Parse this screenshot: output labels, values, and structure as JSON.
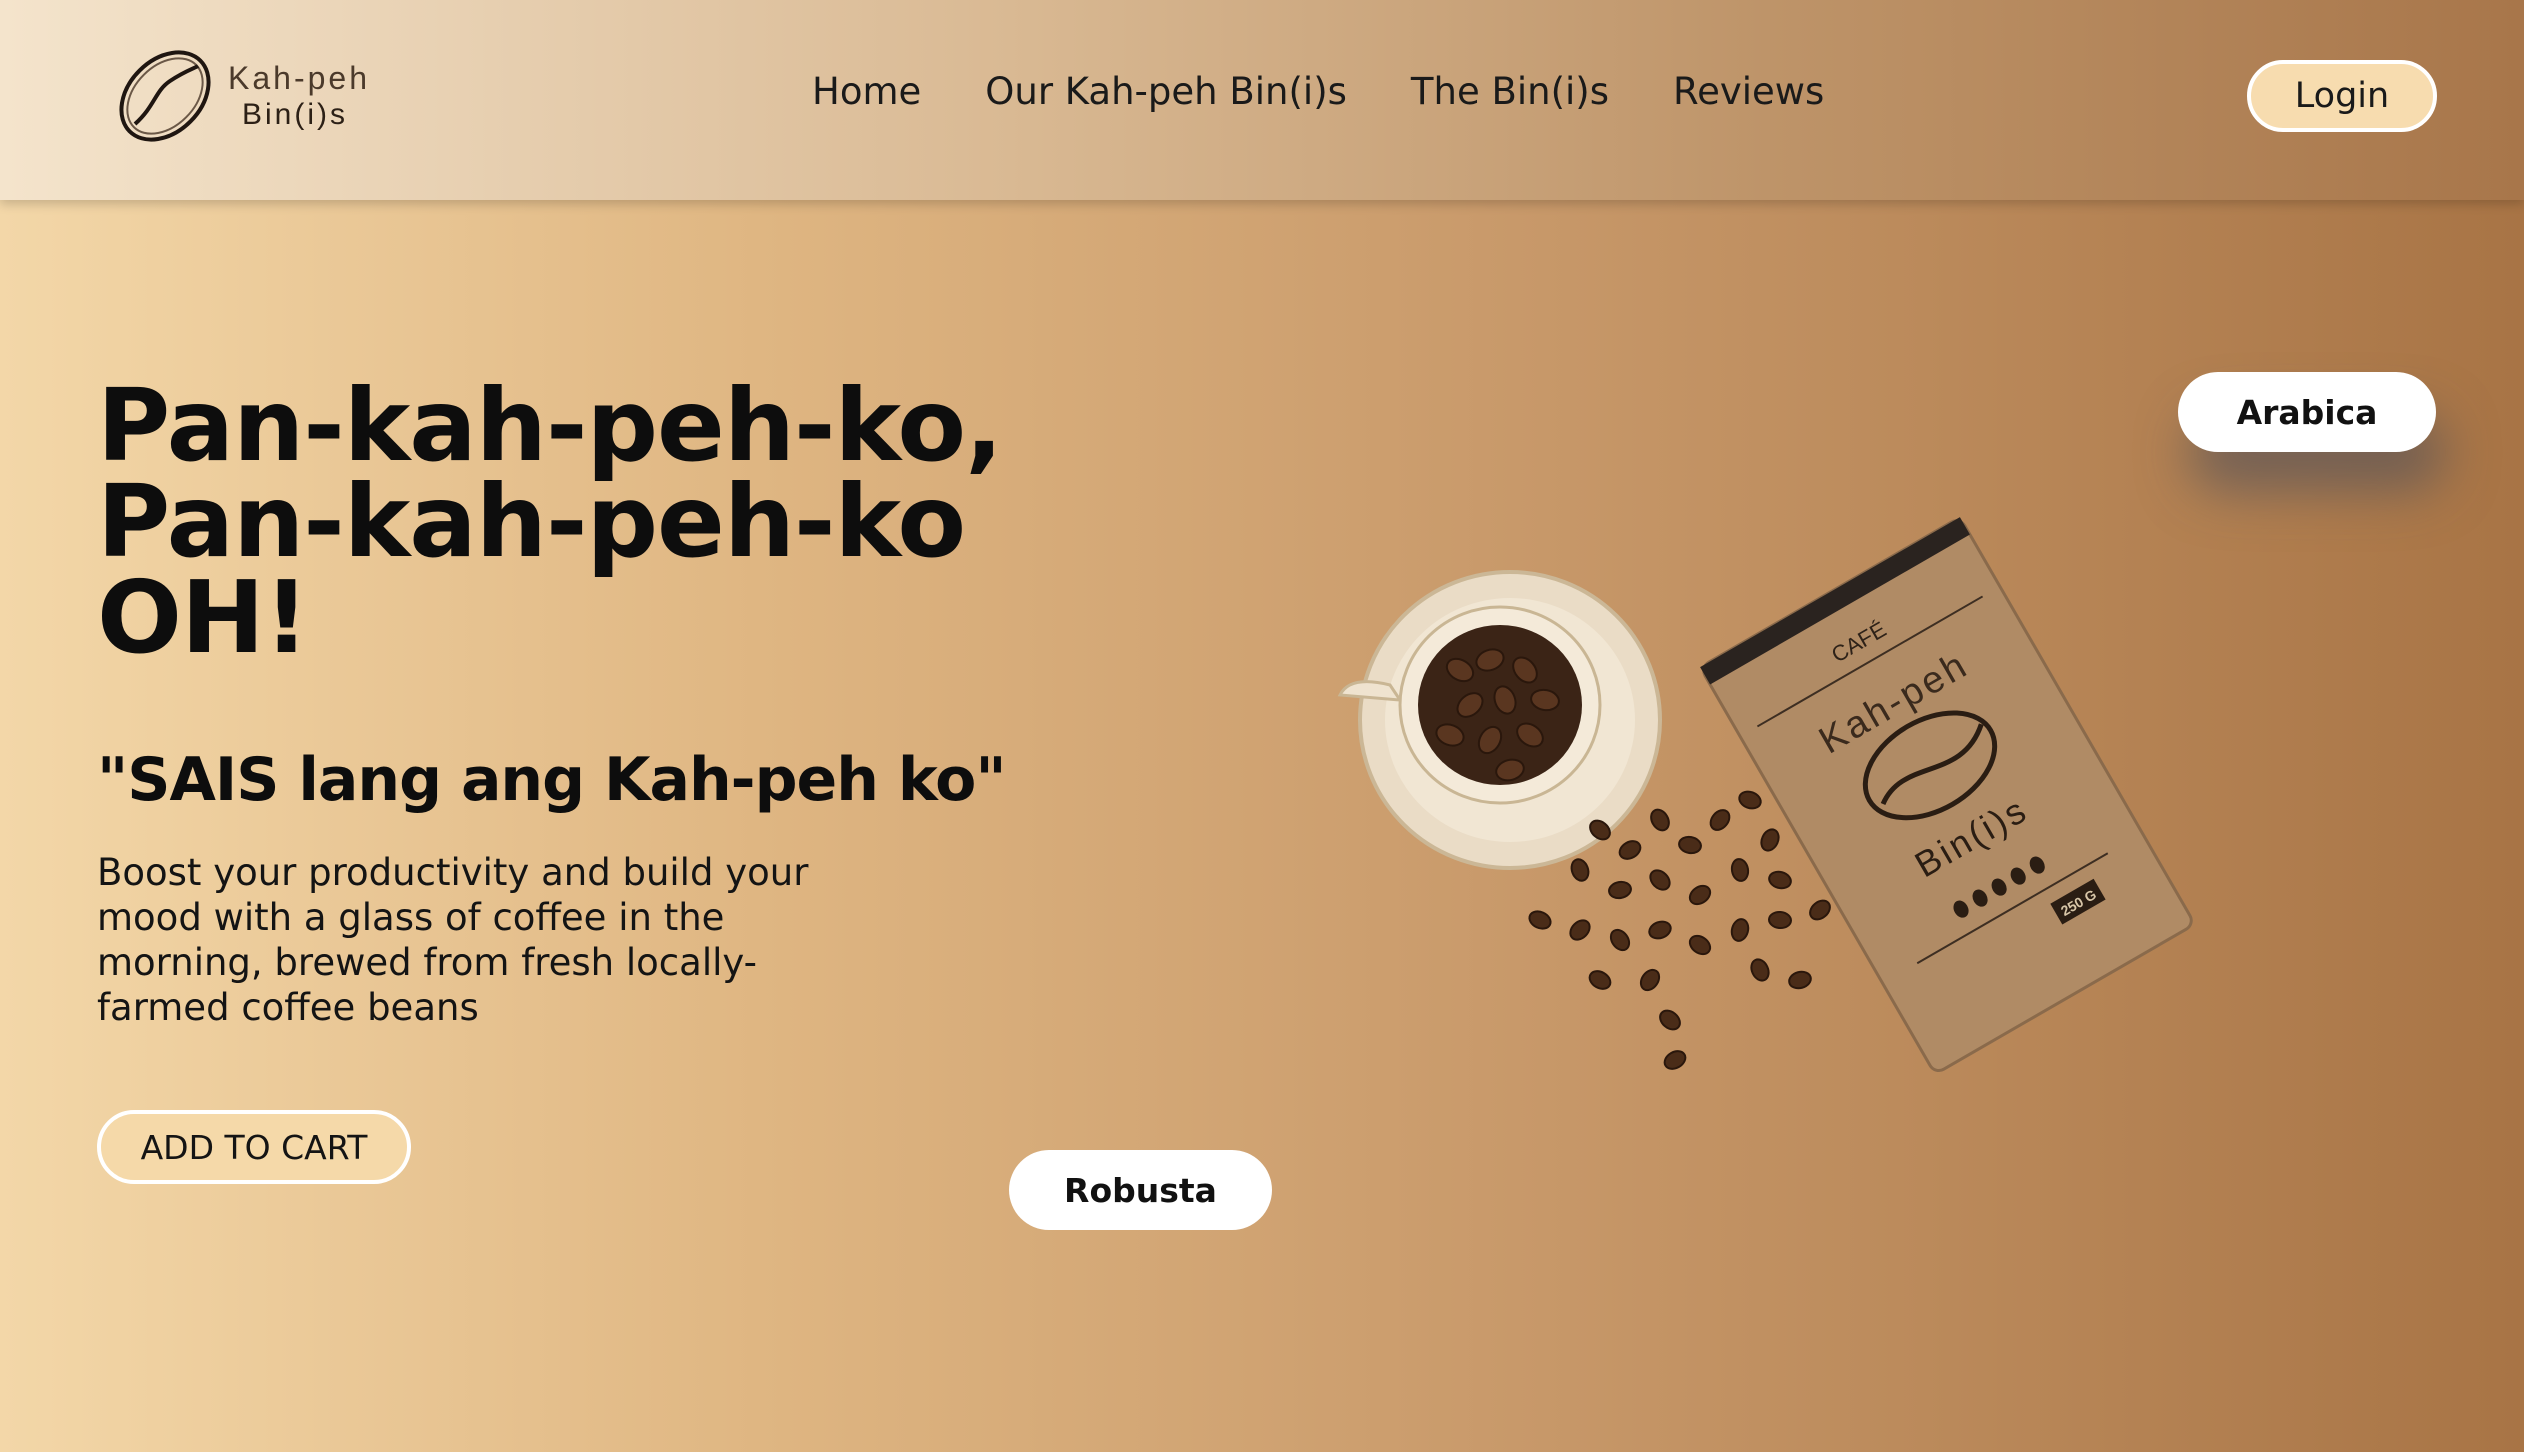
{
  "brand": {
    "line1": "Kah-peh",
    "line2": "Bin(i)s"
  },
  "nav": {
    "items": [
      {
        "label": "Home"
      },
      {
        "label": "Our Kah-peh Bin(i)s"
      },
      {
        "label": "The Bin(i)s"
      },
      {
        "label": "Reviews"
      }
    ],
    "login_label": "Login"
  },
  "hero": {
    "title_lines": [
      "Pan-kah-peh-ko,",
      "Pan-kah-peh-ko",
      "OH!"
    ],
    "tagline": "\"SAIS lang ang Kah-peh ko\"",
    "body": "Boost your productivity and build your mood with a glass of coffee in the morning, brewed from fresh locally-farmed coffee beans",
    "cta_label": "ADD TO CART"
  },
  "variants": {
    "arabica": "Arabica",
    "robusta": "Robusta"
  },
  "product_image": {
    "bag_label_top": "CAFÉ",
    "bag_brand_line1": "Kah-peh",
    "bag_brand_line2": "Bin(i)s",
    "bag_weight": "250 G",
    "icons": [
      "coffee-cup-icon",
      "coffee-bag-icon",
      "coffee-bean-icon"
    ]
  },
  "colors": {
    "cta_fill": "#f5d9a9",
    "login_fill": "#f7dcaf",
    "text": "#0d0d0d"
  }
}
